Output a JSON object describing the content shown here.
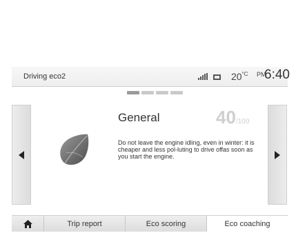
{
  "status_bar": {
    "app_title": "Driving eco2",
    "temperature": "20",
    "temperature_unit": "°C",
    "period": "PM",
    "time": "6:40"
  },
  "page_indicator": {
    "count": 4,
    "active_index": 0
  },
  "content": {
    "title": "General",
    "score": {
      "value": "40",
      "max": "/100"
    },
    "advice": "Do not leave the engine idling, even in winter: it is cheaper and less pol-luting to drive offas soon as you start the engine."
  },
  "tabs": {
    "home_icon": "home-icon",
    "trip_report": "Trip report",
    "eco_scoring": "Eco scoring",
    "eco_coaching": "Eco coaching"
  },
  "colors": {
    "score_gray": "#cfcfcf",
    "leaf_gray": "#6f6f6f",
    "tab_active": "#ffffff"
  }
}
